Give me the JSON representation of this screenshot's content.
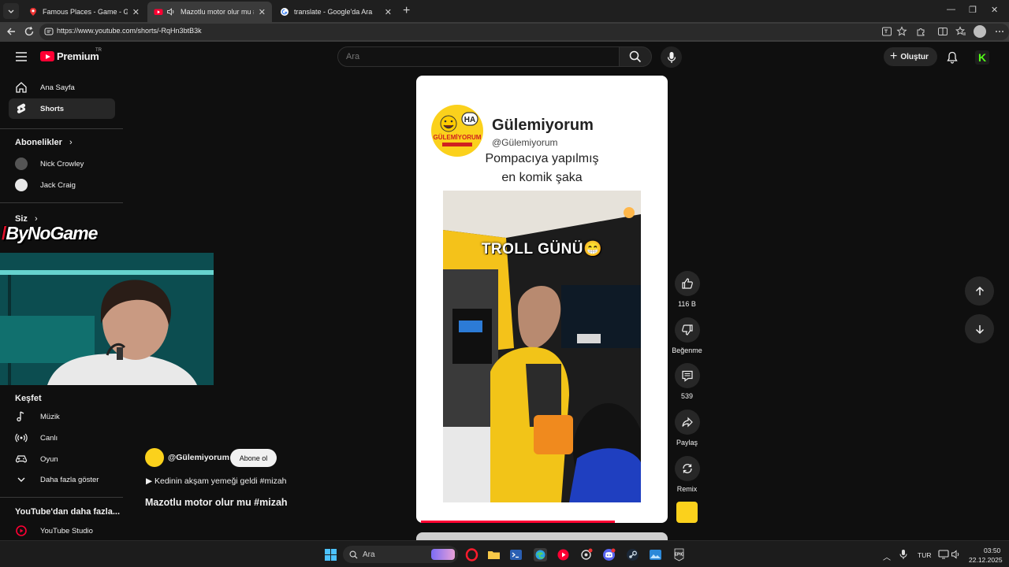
{
  "browser": {
    "tabs": [
      {
        "title": "Famous Places - Game - GeoGuessr",
        "icon": "map-pin-icon"
      },
      {
        "title": "Mazotlu motor olur mu #mizah",
        "icon": "youtube-icon",
        "audio": true
      },
      {
        "title": "translate - Google'da Ara",
        "icon": "google-icon"
      }
    ],
    "url": "https://www.youtube.com/shorts/-RqHn3btB3k"
  },
  "youtube": {
    "logo_text": "Premium",
    "region": "TR",
    "search_placeholder": "Ara",
    "create_label": "Oluştur"
  },
  "sidebar": {
    "primary": [
      {
        "label": "Ana Sayfa",
        "icon": "home-icon"
      },
      {
        "label": "Shorts",
        "icon": "shorts-icon",
        "active": true
      }
    ],
    "subscriptions_header": "Abonelikler",
    "subscriptions": [
      {
        "label": "Nick Crowley"
      },
      {
        "label": "Jack Craig"
      }
    ],
    "you_header": "Siz",
    "explore_header": "Keşfet",
    "explore": [
      {
        "label": "Müzik",
        "icon": "music-icon"
      },
      {
        "label": "Canlı",
        "icon": "live-icon"
      },
      {
        "label": "Oyun",
        "icon": "gaming-icon"
      },
      {
        "label": "Daha fazla göster",
        "icon": "chevron-down-icon"
      }
    ],
    "more_header": "YouTube'dan daha fazla...",
    "more": [
      {
        "label": "YouTube Studio",
        "icon": "studio-icon"
      }
    ]
  },
  "overlay": {
    "brand": "ByNoGame"
  },
  "short": {
    "channel_name": "Gülemiyorum",
    "channel_handle": "@Gülemiyorum",
    "caption_line1": "Pompacıya yapılmış",
    "caption_line2": "en komik şaka",
    "logo_text": "GÜLEMİYORUM",
    "logo_badge": "HA",
    "video_overlay_text": "TROLL GÜNÜ😁",
    "progress_fraction": 0.8
  },
  "actions": {
    "like_count": "116 B",
    "dislike_label": "Beğenme",
    "comment_count": "539",
    "share_label": "Paylaş",
    "remix_label": "Remix"
  },
  "info": {
    "handle": "@Gülemiyorum",
    "subscribe_label": "Abone ol",
    "description": "▶ Kedinin akşam yemeği geldi #mizah ",
    "title": "Mazotlu motor olur mu #mizah "
  },
  "taskbar": {
    "search_label": "Ara",
    "language": "TUR",
    "time": "03:50",
    "date": "22.12.2025"
  }
}
